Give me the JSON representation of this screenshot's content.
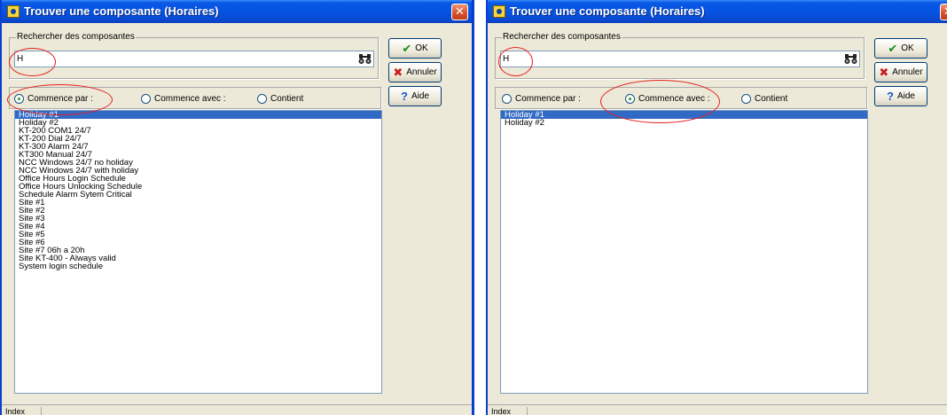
{
  "window": {
    "title": "Trouver une composante (Horaires)",
    "close_glyph": "✕"
  },
  "search": {
    "group_label": "Rechercher des composantes",
    "value": "H"
  },
  "options": {
    "starts_with": "Commence par :",
    "begins_with": "Commence avec :",
    "contains": "Contient"
  },
  "buttons": {
    "ok": "OK",
    "cancel": "Annuler",
    "help": "Aide"
  },
  "status": {
    "index_label": "Index"
  },
  "left_panel": {
    "selected_option": "starts_with",
    "items": [
      "Holiday #1",
      "Holiday #2",
      "KT-200 COM1 24/7",
      "KT-200 Dial 24/7",
      "KT-300 Alarm 24/7",
      "KT300 Manual 24/7",
      "NCC Windows 24/7 no holiday",
      "NCC Windows 24/7 with holiday",
      "Office Hours Login Schedule",
      "Office Hours Unlocking Schedule",
      "Schedule Alarm Sytem Critical",
      "Site #1",
      "Site #2",
      "Site #3",
      "Site #4",
      "Site #5",
      "Site #6",
      "Site #7 06h a 20h",
      "Site KT-400 - Always valid",
      "System login schedule"
    ]
  },
  "right_panel": {
    "selected_option": "begins_with",
    "items": [
      "Holiday #1",
      "Holiday #2"
    ]
  },
  "colors": {
    "title_bar": "#0553e0",
    "dialog_bg": "#ece9d8",
    "selection": "#316ac5",
    "annotation": "#e61e1e"
  },
  "icons": {
    "app": "app-icon",
    "search": "binoculars-icon",
    "ok": "checkmark-icon",
    "cancel": "x-icon",
    "help": "question-mark-icon"
  }
}
